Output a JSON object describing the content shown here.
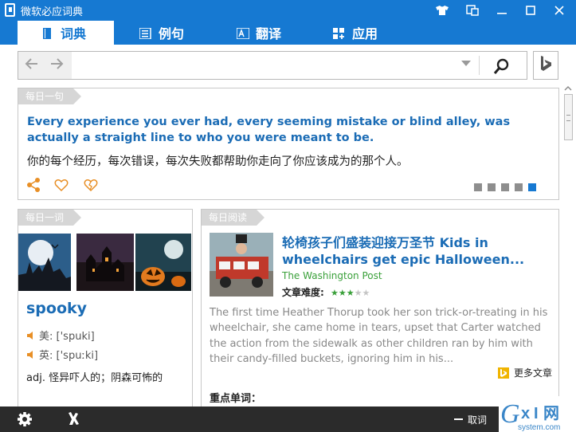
{
  "window": {
    "title": "微软必应词典"
  },
  "tabs": [
    {
      "label": "词典"
    },
    {
      "label": "例句"
    },
    {
      "label": "翻译"
    },
    {
      "label": "应用"
    }
  ],
  "search": {
    "value": "",
    "placeholder": ""
  },
  "daily_quote": {
    "tag": "每日一句",
    "english": "Every experience you ever had, every seeming mistake or blind alley, was actually a straight line to who you were meant to be.",
    "chinese": "你的每个经历，每次错误，每次失败都帮助你走向了你应该成为的那个人。",
    "icons": [
      "share-icon",
      "heart-icon",
      "broken-heart-icon"
    ],
    "page_count": 5,
    "active_page": 5
  },
  "daily_word": {
    "tag": "每日一词",
    "word": "spooky",
    "us_label": "美:",
    "us_phonetic": "['spuki]",
    "uk_label": "英:",
    "uk_phonetic": "['spuːki]",
    "definition": "adj. 怪异吓人的；阴森可怖的"
  },
  "daily_reading": {
    "tag": "每日阅读",
    "title": "轮椅孩子们盛装迎接万圣节  Kids in wheelchairs get epic Halloween...",
    "source": "The Washington Post",
    "difficulty_label": "文章难度:",
    "difficulty": 3,
    "difficulty_max": 5,
    "body": "The first time Heather Thorup took her son trick-or-treating in his wheelchair, she came home in tears, upset that Carter watched the action from the sidewalk as other children ran by him with their candy-filled buckets, ignoring him in his...",
    "more": "更多文章",
    "key_words_label": "重点单词："
  },
  "bottom": {
    "exit_label": "取词"
  },
  "colors": {
    "accent": "#1679d2",
    "link": "#1b6cb5",
    "green": "#3aa03a",
    "orange": "#e88f26",
    "bottom_bar": "#2b2b2b"
  }
}
